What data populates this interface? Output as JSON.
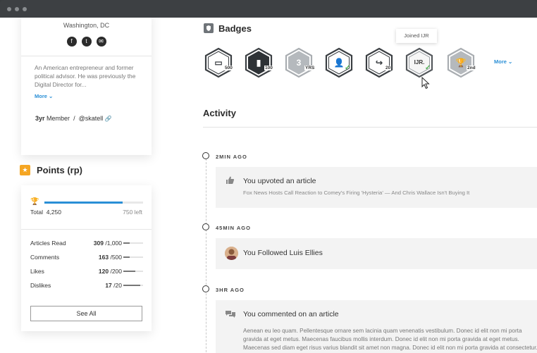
{
  "profile": {
    "location": "Washington, DC",
    "socials": [
      {
        "icon": "facebook-icon",
        "glyph": "f"
      },
      {
        "icon": "twitter-icon",
        "glyph": "t"
      },
      {
        "icon": "email-icon",
        "glyph": "✉"
      }
    ],
    "bio": "An American entrepreneur and former political advisor. He was previously the Digital Director for...",
    "more_label": "More ⌄",
    "member_years": "3yr",
    "member_word": "Member",
    "separator": "/",
    "handle": "@skatell",
    "link_icon": "🔗"
  },
  "points": {
    "title": "Points (rp)",
    "star": "★",
    "trophy": "🏆",
    "total_label": "Total",
    "total_value": "4,250",
    "progress_fraction": 0.79,
    "left_label": "750 left",
    "stats": [
      {
        "name": "Articles Read",
        "value": "309",
        "max": "/1,000",
        "fraction": 0.31
      },
      {
        "name": "Comments",
        "value": "163",
        "max": "/500",
        "fraction": 0.33
      },
      {
        "name": "Likes",
        "value": "120",
        "max": "/200",
        "fraction": 0.6
      },
      {
        "name": "Dislikes",
        "value": "17",
        "max": "/20",
        "fraction": 0.85
      }
    ],
    "see_all": "See All"
  },
  "badges": {
    "title": "Badges",
    "items": [
      {
        "icon": "comment-badge-icon",
        "inner": "▭",
        "label": "500",
        "style": "outline",
        "check": false
      },
      {
        "icon": "article-badge-icon",
        "inner": "▮",
        "label": "100",
        "style": "dark",
        "check": false
      },
      {
        "icon": "years-badge-icon",
        "inner": "3",
        "label": "YRS",
        "style": "gray",
        "check": false
      },
      {
        "icon": "profile-badge-icon",
        "inner": "👤",
        "label": "",
        "style": "outline",
        "check": true
      },
      {
        "icon": "share-badge-icon",
        "inner": "↪",
        "label": "20",
        "style": "outline",
        "check": false
      },
      {
        "icon": "ijr-badge-icon",
        "inner": "IJR.",
        "label": "",
        "style": "outline-light",
        "check": true
      },
      {
        "icon": "trophy-badge-icon",
        "inner": "🏆",
        "label": "2nd",
        "style": "gray",
        "check": false
      }
    ],
    "tooltip": "Joined IJR",
    "more_label": "More ⌄"
  },
  "activity": {
    "title": "Activity",
    "items": [
      {
        "time": "2MIN AGO",
        "icon": "thumbs-up-icon",
        "title": "You upvoted an article",
        "subtitle": "Fox News Hosts Call Reaction to Comey's Firing 'Hysteria' — And Chris Wallace Isn't Buying It"
      },
      {
        "time": "45MIN AGO",
        "icon": "avatar",
        "title": "You Followed Luis Ellies"
      },
      {
        "time": "3HR AGO",
        "icon": "comment-icon",
        "title": "You commented on an article",
        "body": [
          "Aenean eu leo quam. Pellentesque ornare sem lacinia quam venenatis vestibulum. Donec id elit non mi porta",
          "gravida at eget metus. Maecenas faucibus mollis interdum. Donec id elit non mi porta gravida at eget metus.",
          "Maecenas sed diam eget risus varius blandit sit amet non magna. Donec id elit non mi porta gravida at consectetur."
        ]
      }
    ]
  }
}
